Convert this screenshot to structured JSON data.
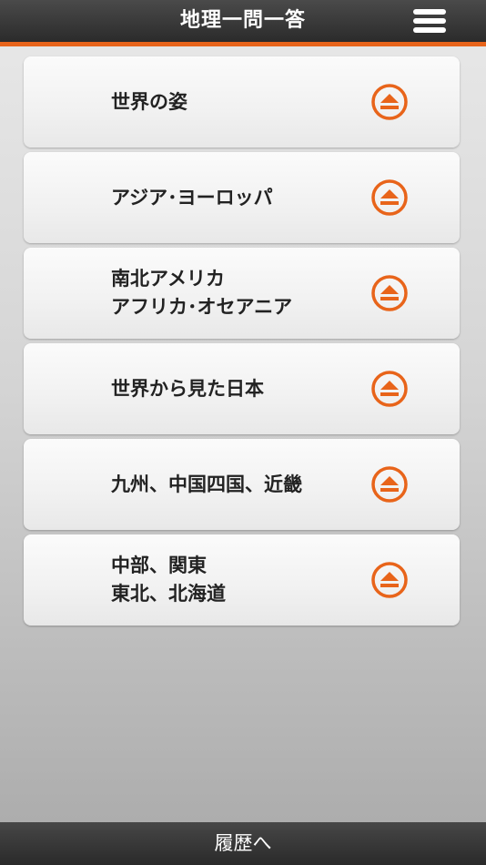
{
  "header": {
    "title": "地理一問一答",
    "menu_icon": "hamburger-menu-icon"
  },
  "colors": {
    "accent": "#e8641a",
    "header_bg": "#333333",
    "card_bg": "#f4f4f4",
    "text": "#222222"
  },
  "items": [
    {
      "line1": "世界の姿",
      "line2": "",
      "icon": "eject-circle-icon"
    },
    {
      "line1": "アジア･ヨーロッパ",
      "line2": "",
      "icon": "eject-circle-icon"
    },
    {
      "line1": "南北アメリカ",
      "line2": "アフリカ･オセアニア",
      "icon": "eject-circle-icon"
    },
    {
      "line1": "世界から見た日本",
      "line2": "",
      "icon": "eject-circle-icon"
    },
    {
      "line1": "九州、中国四国、近畿",
      "line2": "",
      "icon": "eject-circle-icon"
    },
    {
      "line1": "中部、関東",
      "line2": "東北、北海道",
      "icon": "eject-circle-icon"
    }
  ],
  "footer": {
    "label": "履歴へ"
  }
}
